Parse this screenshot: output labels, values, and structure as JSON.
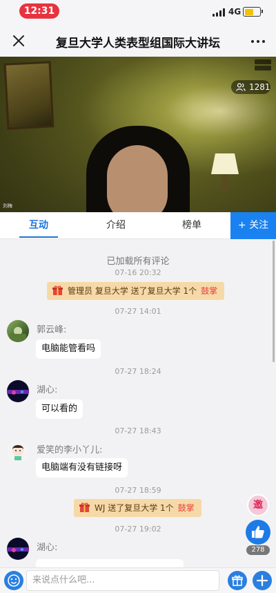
{
  "status_bar": {
    "time": "12:31",
    "network": "4G"
  },
  "nav": {
    "title": "复旦大学人类表型组国际大讲坛"
  },
  "video": {
    "viewer_count": "1281",
    "speaker_tag": "刘梅"
  },
  "tabs": [
    {
      "label": "互动",
      "active": true
    },
    {
      "label": "介绍",
      "active": false
    },
    {
      "label": "榜单",
      "active": false
    }
  ],
  "follow_label": "+ 关注",
  "chat": {
    "loaded_notice": "已加载所有评论",
    "timestamps": [
      "07-16 20:32",
      "07-27 14:01",
      "07-27 18:24",
      "07-27 18:43",
      "07-27 18:59",
      "07-27 19:02"
    ],
    "gifts": [
      {
        "text": "管理员 复旦大学 送了复旦大学 1个",
        "action": "鼓掌"
      },
      {
        "text": "WJ 送了复旦大学 1个",
        "action": "鼓掌"
      }
    ],
    "messages": [
      {
        "user": "郭云峰:",
        "text": "电脑能管看吗"
      },
      {
        "user": "湖心:",
        "text": "可以看的"
      },
      {
        "user": "爱笑的李小丫儿:",
        "text": "电脑端有没有链接呀"
      },
      {
        "user": "湖心:",
        "text": ""
      }
    ]
  },
  "floating": {
    "invite_label": "邀",
    "like_count": "278"
  },
  "input": {
    "placeholder": "来说点什么吧..."
  },
  "colors": {
    "accent": "#1a82f0",
    "gift_bg": "#f6d9a8",
    "clap": "#e4433a",
    "time_pill": "#e8333f"
  }
}
